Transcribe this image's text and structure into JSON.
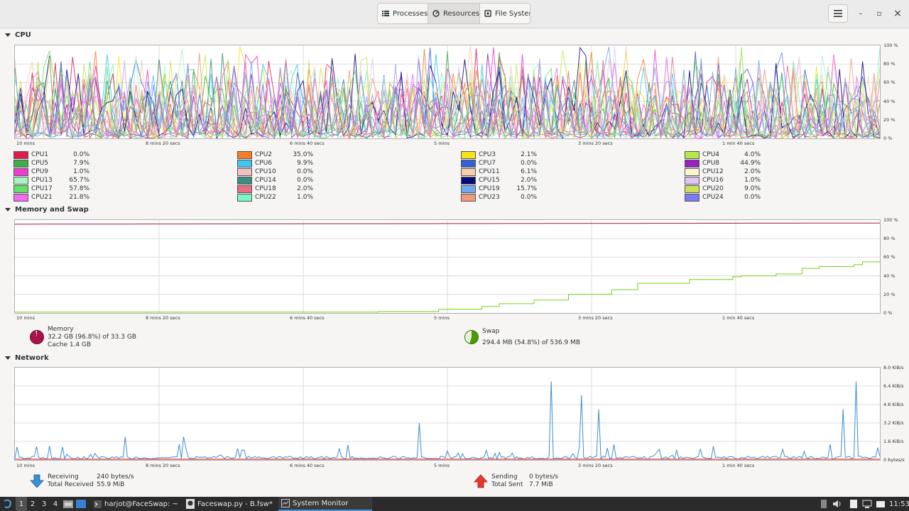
{
  "header": {
    "tabs": [
      {
        "label": "Processes",
        "icon": "list-icon"
      },
      {
        "label": "Resources",
        "icon": "gauge-icon"
      },
      {
        "label": "File Syster",
        "icon": "disk-icon"
      }
    ],
    "active_tab": "Resources",
    "menu_icon": "hamburger-icon",
    "minimize_glyph": "–",
    "maximize_glyph": "▫",
    "close_glyph": "×"
  },
  "cpu": {
    "title": "CPU",
    "y_ticks": [
      "100 %",
      "80 %",
      "60 %",
      "40 %",
      "20 %",
      "0 %"
    ],
    "x_ticks": [
      "10 mins",
      "8 mins 20 secs",
      "6 mins 40 secs",
      "5 mins",
      "3 mins 20 secs",
      "1 min 40 secs"
    ],
    "cores": [
      {
        "name": "CPU1",
        "value": "0.0%",
        "color": "#e01b4c"
      },
      {
        "name": "CPU2",
        "value": "35.0%",
        "color": "#f57d25"
      },
      {
        "name": "CPU3",
        "value": "2.1%",
        "color": "#f8e21c"
      },
      {
        "name": "CPU4",
        "value": "4.0%",
        "color": "#b8e84a"
      },
      {
        "name": "CPU5",
        "value": "7.9%",
        "color": "#3fae49"
      },
      {
        "name": "CPU6",
        "value": "9.9%",
        "color": "#3ec8f0"
      },
      {
        "name": "CPU7",
        "value": "0.0%",
        "color": "#3461d7"
      },
      {
        "name": "CPU8",
        "value": "44.9%",
        "color": "#9d1ec2"
      },
      {
        "name": "CPU9",
        "value": "1.0%",
        "color": "#ee3bd2"
      },
      {
        "name": "CPU10",
        "value": "0.0%",
        "color": "#f5bfc6"
      },
      {
        "name": "CPU11",
        "value": "6.1%",
        "color": "#f6ceab"
      },
      {
        "name": "CPU12",
        "value": "2.0%",
        "color": "#fbf5d0"
      },
      {
        "name": "CPU13",
        "value": "65.7%",
        "color": "#a5f6c3"
      },
      {
        "name": "CPU14",
        "value": "0.0%",
        "color": "#3c8c7f"
      },
      {
        "name": "CPU15",
        "value": "2.0%",
        "color": "#0b0a7a"
      },
      {
        "name": "CPU16",
        "value": "1.0%",
        "color": "#e2c5f7"
      },
      {
        "name": "CPU17",
        "value": "57.8%",
        "color": "#62e06a"
      },
      {
        "name": "CPU18",
        "value": "2.0%",
        "color": "#ec6b85"
      },
      {
        "name": "CPU19",
        "value": "15.7%",
        "color": "#6fa8f3"
      },
      {
        "name": "CPU20",
        "value": "9.0%",
        "color": "#cde05b"
      },
      {
        "name": "CPU21",
        "value": "21.8%",
        "color": "#f36bf2"
      },
      {
        "name": "CPU22",
        "value": "1.0%",
        "color": "#7af5c4"
      },
      {
        "name": "CPU23",
        "value": "0.0%",
        "color": "#f19a7a"
      },
      {
        "name": "CPU24",
        "value": "0.0%",
        "color": "#7c7cf2"
      }
    ]
  },
  "memory": {
    "title": "Memory and Swap",
    "y_ticks": [
      "100 %",
      "80 %",
      "60 %",
      "40 %",
      "20 %",
      "0 %"
    ],
    "x_ticks": [
      "10 mins",
      "8 mins 20 secs",
      "6 mins 40 secs",
      "5 mins",
      "3 mins 20 secs",
      "1 min 40 secs"
    ],
    "memory_label": "Memory",
    "memory_detail": "32.2 GB (96.8%) of 33.3 GB",
    "cache_detail": "Cache 1.4 GB",
    "memory_color": "#a8144a",
    "memory_fraction": 0.968,
    "swap_label": "Swap",
    "swap_detail": "294.4 MB (54.8%) of 536.9 MB",
    "swap_color": "#4e9a06",
    "swap_fraction": 0.548
  },
  "network": {
    "title": "Network",
    "y_ticks": [
      "8.0 KiB/s",
      "6.4 KiB/s",
      "4.8 KiB/s",
      "3.2 KiB/s",
      "1.6 KiB/s",
      "0 bytes/s"
    ],
    "x_ticks": [
      "10 mins",
      "8 mins 20 secs",
      "6 mins 40 secs",
      "5 mins",
      "3 mins 20 secs",
      "1 min 40 secs"
    ],
    "receiving_label": "Receiving",
    "receiving_value": "240 bytes/s",
    "total_received_label": "Total Received",
    "total_received_value": "55.9 MiB",
    "sending_label": "Sending",
    "sending_value": "0 bytes/s",
    "total_sent_label": "Total Sent",
    "total_sent_value": "7.7 MiB",
    "receive_color": "#3a8fd1",
    "send_color": "#e8372c"
  },
  "taskbar": {
    "workspaces": [
      "1",
      "2",
      "3",
      "4"
    ],
    "tasks": [
      {
        "label": "harjot@FaceSwap: ~",
        "icon": "terminal-icon"
      },
      {
        "label": "Faceswap.py - B.fsw*",
        "icon": "faceswap-icon"
      },
      {
        "label": "System Monitor",
        "icon": "monitor-icon"
      }
    ],
    "clock": "11:53"
  }
}
